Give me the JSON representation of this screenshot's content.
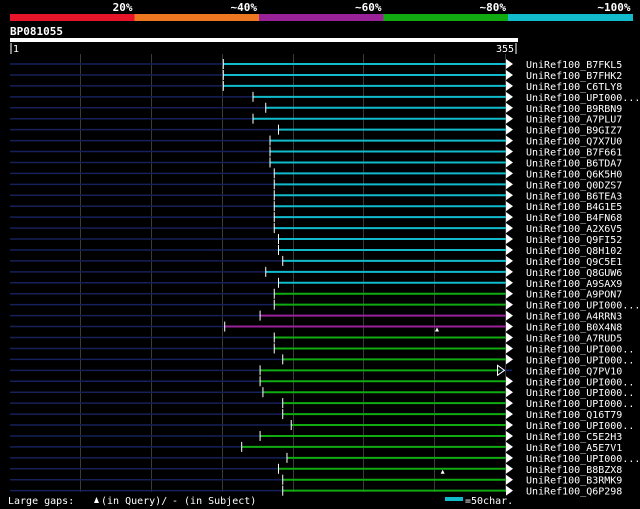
{
  "chart_data": {
    "type": "bar",
    "query_id": "BP081055",
    "query_start": 1,
    "query_end": 355,
    "identity_legend": [
      {
        "label": "20%",
        "color": "#e8152a"
      },
      {
        "label": "~40%",
        "color": "#ee7722"
      },
      {
        "label": "~60%",
        "color": "#992299"
      },
      {
        "label": "~80%",
        "color": "#11aa11"
      },
      {
        "label": "~100%",
        "color": "#11bbcc"
      }
    ],
    "hits": [
      {
        "name": "UniRef100_B7FKL5",
        "start": 151,
        "end": 355,
        "color": "#11bbcc",
        "marker": null,
        "arrow": "filled"
      },
      {
        "name": "UniRef100_B7FHK2",
        "start": 151,
        "end": 355,
        "color": "#11bbcc",
        "marker": null,
        "arrow": "filled"
      },
      {
        "name": "UniRef100_C6TLY8",
        "start": 151,
        "end": 355,
        "color": "#11bbcc",
        "marker": null,
        "arrow": "filled"
      },
      {
        "name": "UniRef100_UPI000...",
        "start": 172,
        "end": 355,
        "color": "#11bbcc",
        "marker": null,
        "arrow": "filled"
      },
      {
        "name": "UniRef100_B9RBN9",
        "start": 181,
        "end": 355,
        "color": "#11bbcc",
        "marker": null,
        "arrow": "filled"
      },
      {
        "name": "UniRef100_A7PLU7",
        "start": 172,
        "end": 355,
        "color": "#11bbcc",
        "marker": null,
        "arrow": "filled"
      },
      {
        "name": "UniRef100_B9GIZ7",
        "start": 190,
        "end": 355,
        "color": "#11bbcc",
        "marker": null,
        "arrow": "filled"
      },
      {
        "name": "UniRef100_Q7X7U0",
        "start": 184,
        "end": 355,
        "color": "#11bbcc",
        "marker": null,
        "arrow": "filled"
      },
      {
        "name": "UniRef100_B7F661",
        "start": 184,
        "end": 355,
        "color": "#11bbcc",
        "marker": null,
        "arrow": "filled"
      },
      {
        "name": "UniRef100_B6TDA7",
        "start": 184,
        "end": 355,
        "color": "#11bbcc",
        "marker": null,
        "arrow": "filled"
      },
      {
        "name": "UniRef100_Q6K5H0",
        "start": 187,
        "end": 355,
        "color": "#11bbcc",
        "marker": null,
        "arrow": "filled"
      },
      {
        "name": "UniRef100_Q0DZS7",
        "start": 187,
        "end": 355,
        "color": "#11bbcc",
        "marker": null,
        "arrow": "filled"
      },
      {
        "name": "UniRef100_B6TEA3",
        "start": 187,
        "end": 355,
        "color": "#11bbcc",
        "marker": null,
        "arrow": "filled"
      },
      {
        "name": "UniRef100_B4G1E5",
        "start": 187,
        "end": 355,
        "color": "#11bbcc",
        "marker": null,
        "arrow": "filled"
      },
      {
        "name": "UniRef100_B4FN68",
        "start": 187,
        "end": 355,
        "color": "#11bbcc",
        "marker": null,
        "arrow": "filled"
      },
      {
        "name": "UniRef100_A2X6V5",
        "start": 187,
        "end": 355,
        "color": "#11bbcc",
        "marker": null,
        "arrow": "filled"
      },
      {
        "name": "UniRef100_Q9FI52",
        "start": 190,
        "end": 355,
        "color": "#11bbcc",
        "marker": null,
        "arrow": "filled"
      },
      {
        "name": "UniRef100_Q8H102",
        "start": 190,
        "end": 355,
        "color": "#11bbcc",
        "marker": null,
        "arrow": "filled"
      },
      {
        "name": "UniRef100_Q9C5E1",
        "start": 193,
        "end": 355,
        "color": "#11bbcc",
        "marker": null,
        "arrow": "filled"
      },
      {
        "name": "UniRef100_Q8GUW6",
        "start": 181,
        "end": 355,
        "color": "#11bbcc",
        "marker": null,
        "arrow": "filled"
      },
      {
        "name": "UniRef100_A9SAX9",
        "start": 190,
        "end": 355,
        "color": "#11bbcc",
        "marker": null,
        "arrow": "filled"
      },
      {
        "name": "UniRef100_A9PON7",
        "start": 187,
        "end": 355,
        "color": "#11aa11",
        "marker": null,
        "arrow": "filled"
      },
      {
        "name": "UniRef100_UPI000...",
        "start": 187,
        "end": 355,
        "color": "#11aa11",
        "marker": null,
        "arrow": "filled"
      },
      {
        "name": "UniRef100_A4RRN3",
        "start": 177,
        "end": 355,
        "color": "#992299",
        "marker": null,
        "arrow": "filled"
      },
      {
        "name": "UniRef100_B0X4N8",
        "start": 152,
        "end": 355,
        "color": "#992299",
        "marker": 302,
        "arrow": "filled"
      },
      {
        "name": "UniRef100_A7RUD5",
        "start": 187,
        "end": 355,
        "color": "#11aa11",
        "marker": null,
        "arrow": "filled"
      },
      {
        "name": "UniRef100_UPI000..",
        "start": 187,
        "end": 355,
        "color": "#11aa11",
        "marker": null,
        "arrow": "filled"
      },
      {
        "name": "UniRef100_UPI000..",
        "start": 193,
        "end": 355,
        "color": "#11aa11",
        "marker": null,
        "arrow": "filled"
      },
      {
        "name": "UniRef100_Q7PV10",
        "start": 177,
        "end": 349,
        "color": "#11aa11",
        "marker": null,
        "arrow": "open"
      },
      {
        "name": "UniRef100_UPI000..",
        "start": 177,
        "end": 355,
        "color": "#11aa11",
        "marker": null,
        "arrow": "filled"
      },
      {
        "name": "UniRef100_UPI000..",
        "start": 179,
        "end": 355,
        "color": "#11aa11",
        "marker": null,
        "arrow": "filled"
      },
      {
        "name": "UniRef100_UPI000..",
        "start": 193,
        "end": 355,
        "color": "#11aa11",
        "marker": null,
        "arrow": "filled"
      },
      {
        "name": "UniRef100_Q16T79",
        "start": 193,
        "end": 355,
        "color": "#11aa11",
        "marker": null,
        "arrow": "filled"
      },
      {
        "name": "UniRef100_UPI000..",
        "start": 199,
        "end": 355,
        "color": "#11aa11",
        "marker": null,
        "arrow": "filled"
      },
      {
        "name": "UniRef100_C5E2H3",
        "start": 177,
        "end": 355,
        "color": "#11aa11",
        "marker": null,
        "arrow": "filled"
      },
      {
        "name": "UniRef100_A5E7V1",
        "start": 164,
        "end": 355,
        "color": "#11aa11",
        "marker": null,
        "arrow": "filled"
      },
      {
        "name": "UniRef100_UPI000...",
        "start": 196,
        "end": 355,
        "color": "#11aa11",
        "marker": null,
        "arrow": "filled"
      },
      {
        "name": "UniRef100_B8BZX8",
        "start": 190,
        "end": 355,
        "color": "#11aa11",
        "marker": 306,
        "arrow": "filled"
      },
      {
        "name": "UniRef100_B3RMK9",
        "start": 193,
        "end": 355,
        "color": "#11aa11",
        "marker": null,
        "arrow": "filled"
      },
      {
        "name": "UniRef100_Q6P298",
        "start": 193,
        "end": 355,
        "color": "#11aa11",
        "marker": null,
        "arrow": "filled"
      }
    ],
    "footer": {
      "large_gaps": "Large gaps:",
      "in_query": "(in Query)/",
      "in_subject": "- (in Subject)",
      "scale": "=50char."
    }
  }
}
